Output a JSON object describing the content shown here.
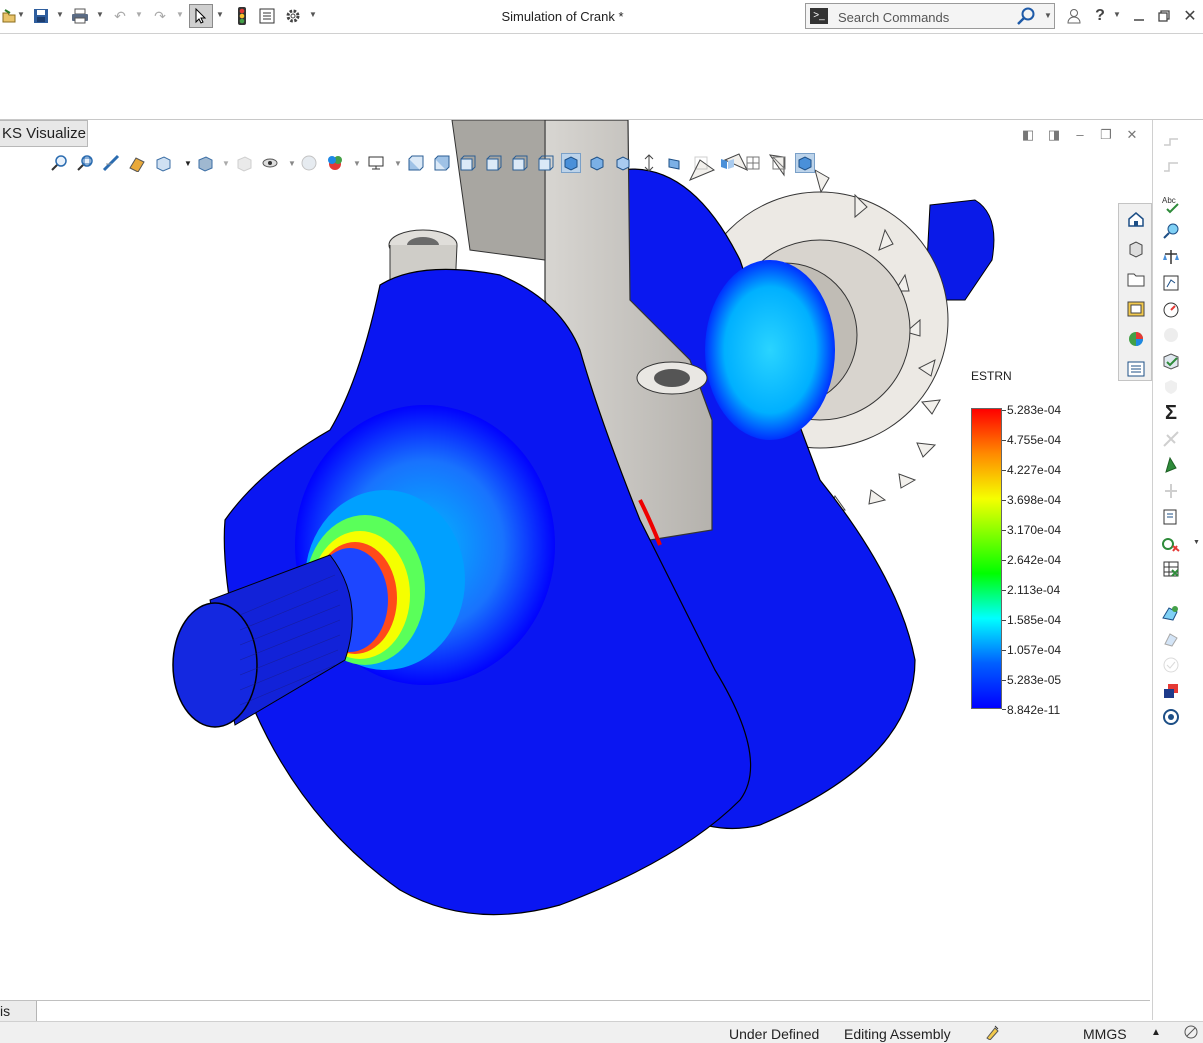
{
  "window": {
    "title": "Simulation of Crank *"
  },
  "search": {
    "placeholder": "Search Commands"
  },
  "tab": {
    "label": "KS Visualize"
  },
  "legend": {
    "title": "ESTRN",
    "values": [
      "5.283e-04",
      "4.755e-04",
      "4.227e-04",
      "3.698e-04",
      "3.170e-04",
      "2.642e-04",
      "2.113e-04",
      "1.585e-04",
      "1.057e-04",
      "5.283e-05",
      "8.842e-11"
    ]
  },
  "bottom_tab": {
    "label": "is"
  },
  "status": {
    "sketch_state": "Under Defined",
    "mode": "Editing Assembly",
    "units": "MMGS",
    "units_caret": "▲"
  },
  "colors": {
    "stress_low": "#0000ff",
    "stress_high": "#ff0000",
    "part_gray": "#d8d6d2"
  }
}
